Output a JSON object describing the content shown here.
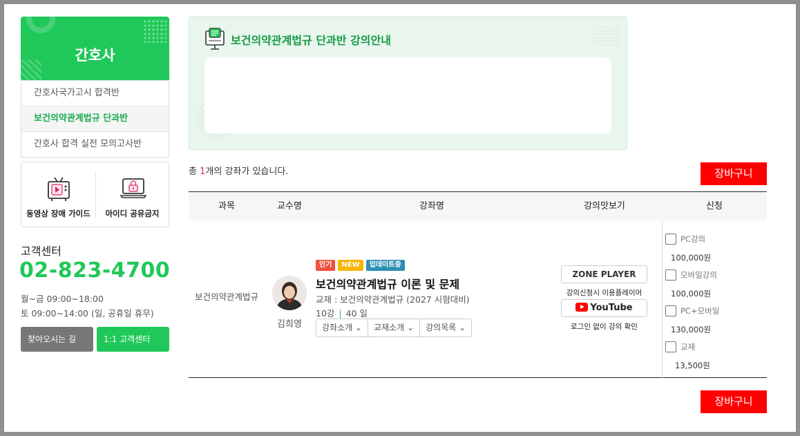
{
  "sidebar": {
    "category": "간호사",
    "items": [
      {
        "label": "간호사국가고시 합격반",
        "active": false
      },
      {
        "label": "보건의약관계법규 단과반",
        "active": true
      },
      {
        "label": "간호사 합격 실전 모의고사반",
        "active": false
      }
    ],
    "guides": [
      {
        "label": "동영상 장애 가이드",
        "icon": "tv-icon"
      },
      {
        "label": "아이디 공유금지",
        "icon": "laptop-lock-icon"
      }
    ],
    "customer_center": {
      "title": "고객센터",
      "phone": "02-823-4700",
      "hours_weekday": "월~금 09:00~18:00",
      "hours_weekend": "토 09:00~14:00 (일, 공휴일 휴무)",
      "map_button": "찾아오시는 길",
      "qa_button": "1:1 고객센터"
    }
  },
  "notice": {
    "title": "보건의약관계법규 단과반 강의안내",
    "icon": "monitor-chat-icon"
  },
  "summary": {
    "prefix": "총 ",
    "count": "1",
    "suffix": "개의 강좌가 있습니다."
  },
  "cart_label": "장바구니",
  "table": {
    "headers": [
      "과목",
      "교수명",
      "강좌명",
      "강의맛보기",
      "신청"
    ],
    "row": {
      "subject": "보건의약관계법규",
      "professor": "김희영",
      "badges": [
        "인기",
        "NEW",
        "업데이트중"
      ],
      "title": "보건의약관계법규 이론 및 문제",
      "book": "교재 : 보건의약관계법규 (2027 시험대비)",
      "lectures": "10강",
      "days": "40 일",
      "meta_sep": "|",
      "buttons": [
        "강좌소개",
        "교재소개",
        "강의목록"
      ],
      "player_label": "ZONE PLAYER",
      "player_caption": "강의신청시 이용플레이어",
      "youtube_label": "YouTube",
      "youtube_caption": "로그인 없이 강의 확인",
      "options": [
        {
          "label": "PC강의",
          "price": "100,000원"
        },
        {
          "label": "모바일강의",
          "price": "100,000원"
        },
        {
          "label": "PC+모바일",
          "price": "130,000원"
        },
        {
          "label": "교재",
          "price": "13,500원"
        }
      ]
    }
  },
  "colors": {
    "brand_green": "#20c859",
    "cart_red": "#ff0000",
    "notice_bg": "#e8f6ee"
  }
}
